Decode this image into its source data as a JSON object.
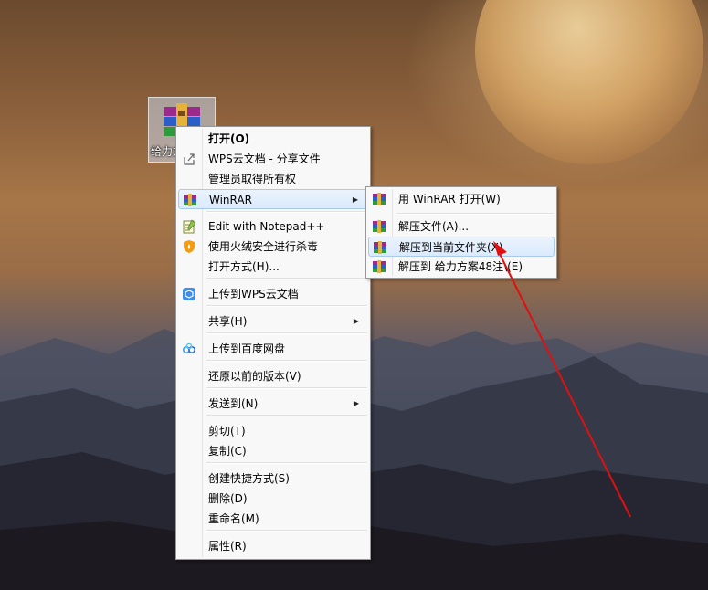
{
  "desktop": {
    "icon_label": "给力方案48注"
  },
  "context_menu": {
    "items": [
      {
        "label": "打开(O)",
        "icon": "",
        "arrow": false,
        "bold": true
      },
      {
        "label": "WPS云文档 - 分享文件",
        "icon": "share-icon",
        "arrow": false
      },
      {
        "label": "管理员取得所有权",
        "icon": "",
        "arrow": false
      },
      {
        "label": "WinRAR",
        "icon": "winrar-icon",
        "arrow": true,
        "highlighted": true
      },
      {
        "label": "Edit with Notepad++",
        "icon": "notepad-icon",
        "arrow": false
      },
      {
        "label": "使用火绒安全进行杀毒",
        "icon": "huorong-shield-icon",
        "arrow": false
      },
      {
        "label": "打开方式(H)...",
        "icon": "",
        "arrow": false
      },
      {
        "label": "上传到WPS云文档",
        "icon": "wps-cloud-icon",
        "arrow": false
      },
      {
        "label": "共享(H)",
        "icon": "",
        "arrow": true
      },
      {
        "label": "上传到百度网盘",
        "icon": "baidu-netdisk-icon",
        "arrow": false
      },
      {
        "label": "还原以前的版本(V)",
        "icon": "",
        "arrow": false
      },
      {
        "label": "发送到(N)",
        "icon": "",
        "arrow": true
      },
      {
        "label": "剪切(T)",
        "icon": "",
        "arrow": false
      },
      {
        "label": "复制(C)",
        "icon": "",
        "arrow": false
      },
      {
        "label": "创建快捷方式(S)",
        "icon": "",
        "arrow": false
      },
      {
        "label": "删除(D)",
        "icon": "",
        "arrow": false
      },
      {
        "label": "重命名(M)",
        "icon": "",
        "arrow": false
      },
      {
        "label": "属性(R)",
        "icon": "",
        "arrow": false
      }
    ]
  },
  "winrar_submenu": {
    "items": [
      {
        "label": "用 WinRAR 打开(W)",
        "icon": "winrar-icon"
      },
      {
        "label": "解压文件(A)...",
        "icon": "winrar-icon"
      },
      {
        "label": "解压到当前文件夹(X)",
        "icon": "winrar-icon",
        "highlighted": true
      },
      {
        "label": "解压到 给力方案48注\\(E)",
        "icon": "winrar-icon"
      }
    ]
  },
  "colors": {
    "menu_bg": "#f8f8f8",
    "highlight_bg": "#dbeafb",
    "highlight_border": "#a8caf0",
    "annotation_arrow": "#e01010"
  }
}
